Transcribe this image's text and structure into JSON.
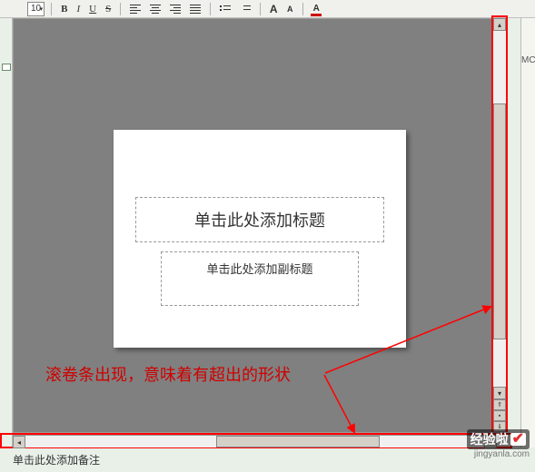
{
  "toolbar": {
    "font_size": "10",
    "bold": "B",
    "italic": "I",
    "underline": "U",
    "strike": "S",
    "font_color_letter": "A",
    "highlight_letter": "A"
  },
  "slide": {
    "title_placeholder": "单击此处添加标题",
    "subtitle_placeholder": "单击此处添加副标题"
  },
  "annotation": {
    "text": "滚卷条出现，意味着有超出的形状"
  },
  "notes": {
    "placeholder": "单击此处添加备注"
  },
  "sidepane": {
    "chars": "MC"
  },
  "watermark": {
    "brand": "经验啦",
    "url": "jingyanla.com"
  }
}
